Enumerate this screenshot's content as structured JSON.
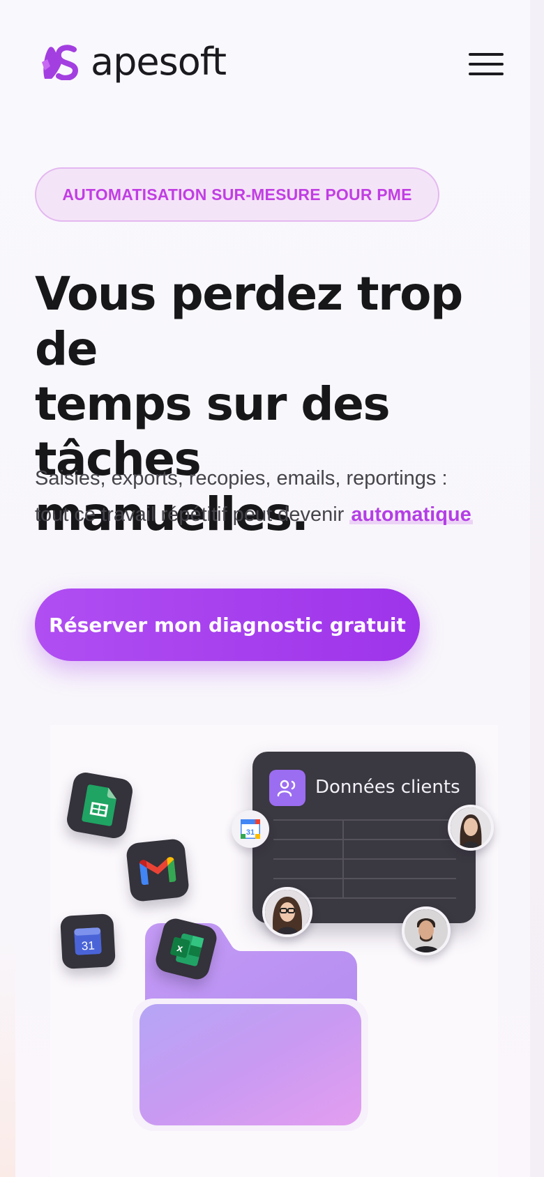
{
  "header": {
    "logo_text": "apesoft",
    "menu_icon": "hamburger-menu-icon"
  },
  "hero": {
    "badge": "AUTOMATISATION SUR-MESURE POUR PME",
    "headline_line1": "Vous perdez trop de",
    "headline_line2": "temps sur des tâches",
    "headline_line3": "manuelles.",
    "subtext_line1": "Saisies, exports, recopies, emails, reportings :",
    "subtext_line2": "tout ce travail répétitif peut devenir ",
    "subtext_highlight": "automatique",
    "cta_label": "Réserver mon diagnostic gratuit"
  },
  "illustration": {
    "card_title": "Données clients",
    "calendar_day": "31",
    "calendar_day_small": "31",
    "apps": [
      "google-sheets-icon",
      "gmail-icon",
      "google-calendar-icon",
      "excel-icon"
    ]
  },
  "colors": {
    "accent": "#b43ee6",
    "cta": "#a441ee",
    "badge_bg": "#f4e4f8",
    "text": "#17171a"
  }
}
